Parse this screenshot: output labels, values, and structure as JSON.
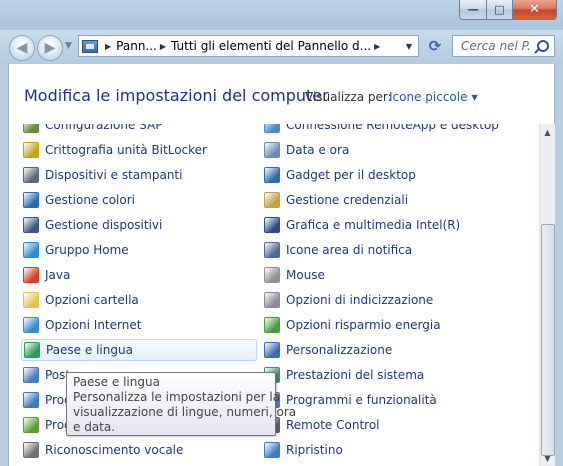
{
  "window": {
    "minimize_glyph": "—",
    "maximize_glyph": "□",
    "close_glyph": "✕"
  },
  "nav": {
    "back_glyph": "◀",
    "forward_glyph": "▶",
    "recent_glyph": "▼",
    "breadcrumb": [
      "Pann...",
      "Tutti gli elementi del Pannello d..."
    ],
    "address_dropdown_glyph": "▼",
    "refresh_glyph": "⟳",
    "search_placeholder": "Cerca nel P..."
  },
  "header": {
    "title": "Modifica le impostazioni del computer",
    "view_label": "Visualizza per:",
    "view_value": "Icone piccole",
    "view_caret": "▼"
  },
  "items_left": [
    {
      "label": "Configurazione SAP",
      "icon": "sap-config-icon",
      "color": "#6a8a3a"
    },
    {
      "label": "Crittografia unità BitLocker",
      "icon": "bitlocker-key-icon",
      "color": "#c8a020"
    },
    {
      "label": "Dispositivi e stampanti",
      "icon": "printer-icon",
      "color": "#5a6a7a"
    },
    {
      "label": "Gestione colori",
      "icon": "monitor-color-icon",
      "color": "#2a6ab8"
    },
    {
      "label": "Gestione dispositivi",
      "icon": "device-manager-icon",
      "color": "#3a5a8a"
    },
    {
      "label": "Gruppo Home",
      "icon": "homegroup-icon",
      "color": "#2a8ad8"
    },
    {
      "label": "Java",
      "icon": "java-icon",
      "color": "#d04020"
    },
    {
      "label": "Opzioni cartella",
      "icon": "folder-icon",
      "color": "#e8c050"
    },
    {
      "label": "Opzioni Internet",
      "icon": "internet-options-icon",
      "color": "#3a8ad0"
    },
    {
      "label": "Paese e lingua",
      "icon": "globe-icon",
      "color": "#2a9a5a"
    },
    {
      "label": "Posta",
      "icon": "mail-icon",
      "color": "#4a7ac0"
    },
    {
      "label": "Programmi",
      "icon": "programs-icon",
      "color": "#3a7ac0"
    },
    {
      "label": "Programmi predefiniti",
      "icon": "default-programs-icon",
      "color": "#5aa030"
    },
    {
      "label": "Riconoscimento vocale",
      "icon": "microphone-icon",
      "color": "#707070"
    }
  ],
  "items_right": [
    {
      "label": "Connessione RemoteApp e desktop",
      "icon": "remoteapp-icon",
      "color": "#4a8ac8"
    },
    {
      "label": "Data e ora",
      "icon": "calendar-clock-icon",
      "color": "#6a8ab8"
    },
    {
      "label": "Gadget per il desktop",
      "icon": "gadget-icon",
      "color": "#2a6ab0"
    },
    {
      "label": "Gestione credenziali",
      "icon": "credential-vault-icon",
      "color": "#c0a040"
    },
    {
      "label": "Grafica e multimedia Intel(R)",
      "icon": "intel-graphics-icon",
      "color": "#2a4a8a"
    },
    {
      "label": "Icone area di notifica",
      "icon": "notification-area-icon",
      "color": "#4a6a9a"
    },
    {
      "label": "Mouse",
      "icon": "mouse-icon",
      "color": "#909090"
    },
    {
      "label": "Opzioni di indicizzazione",
      "icon": "indexing-icon",
      "color": "#8a8a9a"
    },
    {
      "label": "Opzioni risparmio energia",
      "icon": "power-options-icon",
      "color": "#4a9a3a"
    },
    {
      "label": "Personalizzazione",
      "icon": "personalization-icon",
      "color": "#3a6ab0"
    },
    {
      "label": "Prestazioni del sistema",
      "icon": "performance-icon",
      "color": "#4a8a6a"
    },
    {
      "label": "Programmi e funzionalità",
      "icon": "programs-features-icon",
      "color": "#5a7ab0"
    },
    {
      "label": "Remote Control",
      "icon": "remote-control-icon",
      "color": "#606060"
    },
    {
      "label": "Ripristino",
      "icon": "recovery-icon",
      "color": "#3a7ac8"
    }
  ],
  "tooltip": {
    "title": "Paese e lingua",
    "line1": "Personalizza le impostazioni per la",
    "line2": "visualizzazione di lingue, numeri, ora",
    "line3": "e data."
  },
  "scrollbar": {
    "up_glyph": "▲",
    "down_glyph": "▼"
  }
}
